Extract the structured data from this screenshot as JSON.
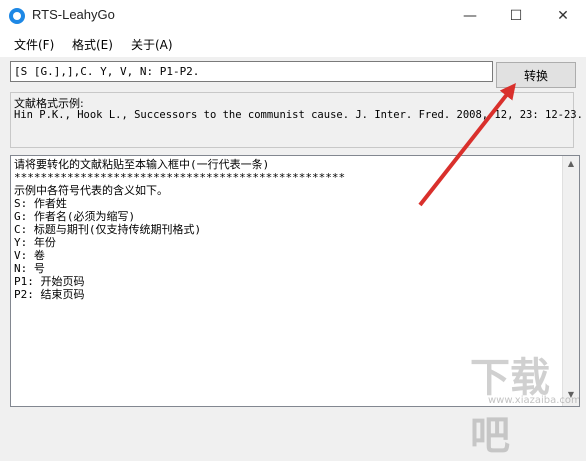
{
  "window": {
    "title": "RTS-LeahyGo",
    "minimize_glyph": "—",
    "maximize_glyph": "☐",
    "close_glyph": "✕"
  },
  "menu": {
    "items": [
      {
        "label": "文件(F)"
      },
      {
        "label": "格式(E)"
      },
      {
        "label": "关于(A)"
      }
    ]
  },
  "format_input": {
    "value": "[S [G.],],C. Y, V, N: P1-P2."
  },
  "convert_button": {
    "label": "转换"
  },
  "sample": {
    "heading": "文献格式示例:",
    "text": "Hin P.K., Hook L., Successors to the communist cause. J. Inter. Fred. 2008, 12, 23: 12-23."
  },
  "main_text": {
    "lines": [
      "请将要转化的文献粘贴至本输入框中(一行代表一条)",
      "**************************************************",
      "示例中各符号代表的含义如下。",
      "S: 作者姓",
      "G: 作者名(必须为缩写)",
      "C: 标题与期刊(仅支持传统期刊格式)",
      "Y: 年份",
      "V: 卷",
      "N: 号",
      "P1: 开始页码",
      "P2: 结束页码"
    ]
  },
  "overlay": {
    "arrow_color": "#d9302c",
    "watermark_text": "下载吧",
    "watermark_url": "www.xiazaiba.com"
  }
}
